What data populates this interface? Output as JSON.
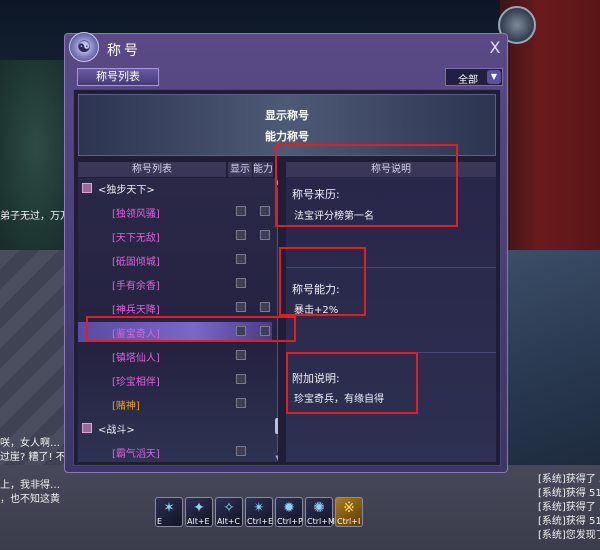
{
  "window": {
    "title": "称号",
    "close_glyph": "X",
    "logo_glyph": "☯",
    "tab_label": "称号列表",
    "filter_value": "全部",
    "filter_icon": "chevron-down-icon"
  },
  "banner": {
    "line1": "显示称号",
    "line2": "能力称号"
  },
  "list": {
    "headers": {
      "name": "称号列表",
      "show": "显示",
      "ability": "能力"
    },
    "group1": "<独步天下>",
    "items": [
      {
        "label": "[独领风骚]"
      },
      {
        "label": "[天下无敌]"
      },
      {
        "label": "[砥固倾城]"
      },
      {
        "label": "[手有余香]"
      },
      {
        "label": "[神兵天降]"
      },
      {
        "label": "[鉴宝奇人]"
      },
      {
        "label": "[镇塔仙人]"
      },
      {
        "label": "[珍宝相伴]"
      },
      {
        "label": "[赌神]"
      }
    ],
    "group2": "<战斗>",
    "item_after": "[霸气滔天]"
  },
  "detail": {
    "header": "称号说明",
    "origin_label": "称号来历:",
    "origin_text": "法宝评分榜第一名",
    "ability_label": "称号能力:",
    "ability_text": "暴击+2%",
    "extra_label": "附加说明:",
    "extra_text": "珍宝奇兵，有缘自得"
  },
  "chat": {
    "top_line": "弟子无过，万万手",
    "bottom_lines": [
      "咲，女人啊…",
      "过崖? 糟了! 不",
      "上，我非得…",
      "，也不知这黄"
    ]
  },
  "sys_log": [
    "[系统]获得了 3",
    "[系统]获得 51",
    "[系统]获得了 3",
    "[系统]获得 51",
    "[系统]您发现了"
  ],
  "skills": [
    {
      "key": "E",
      "glyph": "✶"
    },
    {
      "key": "Alt+E",
      "glyph": "✦"
    },
    {
      "key": "Alt+C",
      "glyph": "✧"
    },
    {
      "key": "Ctrl+E",
      "glyph": "✴"
    },
    {
      "key": "Ctrl+P",
      "glyph": "✹"
    },
    {
      "key": "Ctrl+M",
      "glyph": "✺"
    },
    {
      "key": "Ctrl+I",
      "glyph": "※"
    }
  ],
  "colors": {
    "title_magenta": "#e060e0",
    "title_gold": "#e8a020",
    "annotation_red": "#e02020",
    "window_purple": "#5a4a86"
  }
}
